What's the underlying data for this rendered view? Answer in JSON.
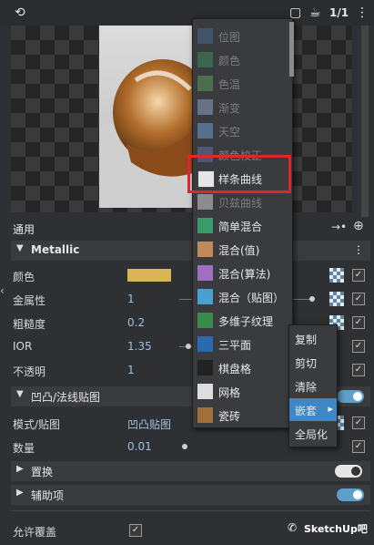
{
  "toolbar": {
    "ratio_label": "1/1",
    "left_icon": "nodes-icon",
    "icons": [
      "square-icon",
      "teapot-icon",
      "more-icon"
    ]
  },
  "panel": {
    "header_label": "通用",
    "material_section": "Metallic",
    "props": {
      "color_label": "颜色",
      "metalness_label": "金属性",
      "metalness_value": "1",
      "roughness_label": "粗糙度",
      "roughness_value": "0.2",
      "ior_label": "IOR",
      "ior_value": "1.35",
      "opacity_label": "不透明",
      "opacity_value": "1"
    },
    "bump_section": "凹凸/法线贴图",
    "bump_mode_label": "模式/贴图",
    "bump_mode_value": "凹凸贴图",
    "bump_amount_label": "数量",
    "bump_amount_value": "0.01",
    "displacement_section": "置换",
    "aux_section": "辅助项",
    "allow_override_label": "允许覆盖",
    "color_swatch": "#d8b457"
  },
  "menu": {
    "items": [
      {
        "label": "位图",
        "enabled": false,
        "icon": "bitmap-icon"
      },
      {
        "label": "颜色",
        "enabled": false,
        "icon": "color-icon"
      },
      {
        "label": "色温",
        "enabled": false,
        "icon": "temperature-icon"
      },
      {
        "label": "渐变",
        "enabled": false,
        "icon": "gradient-icon"
      },
      {
        "label": "天空",
        "enabled": false,
        "icon": "sky-icon"
      },
      {
        "label": "颜色校正",
        "enabled": false,
        "icon": "color-correct-icon"
      },
      {
        "label": "样条曲线",
        "enabled": true,
        "icon": "spline-curve-icon"
      },
      {
        "label": "贝兹曲线",
        "enabled": false,
        "icon": "bezier-curve-icon"
      },
      {
        "label": "简单混合",
        "enabled": true,
        "icon": "simple-mix-icon"
      },
      {
        "label": "混合(值)",
        "enabled": true,
        "icon": "mix-value-icon"
      },
      {
        "label": "混合(算法)",
        "enabled": true,
        "icon": "mix-algo-icon"
      },
      {
        "label": "混合（贴图）",
        "enabled": true,
        "icon": "mix-map-icon"
      },
      {
        "label": "多维子纹理",
        "enabled": true,
        "icon": "multi-sub-icon"
      },
      {
        "label": "三平面",
        "enabled": true,
        "icon": "triplanar-icon"
      },
      {
        "label": "棋盘格",
        "enabled": true,
        "icon": "checker-icon"
      },
      {
        "label": "网格",
        "enabled": true,
        "icon": "grid-icon"
      },
      {
        "label": "瓷砖",
        "enabled": true,
        "icon": "tiles-icon"
      }
    ]
  },
  "context_menu": {
    "items": [
      "复制",
      "剪切",
      "清除",
      "嵌套",
      "全局化"
    ],
    "selected": "嵌套"
  },
  "watermark": {
    "text": "SketchUp吧"
  },
  "colors": {
    "highlight_border": "#e2252a",
    "accent": "#3f86c4"
  }
}
